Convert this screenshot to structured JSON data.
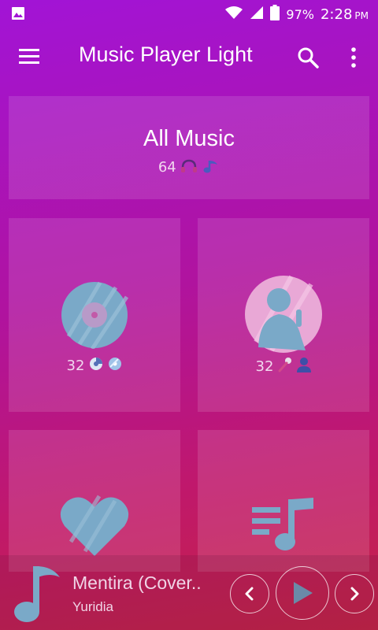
{
  "status": {
    "battery": "97%",
    "time": "2:28",
    "ampm": "PM"
  },
  "appbar": {
    "title": "Music Player Light"
  },
  "all_music": {
    "title": "All Music",
    "count": "64"
  },
  "albums": {
    "count": "32"
  },
  "artists": {
    "count": "32"
  },
  "now_playing": {
    "title": "Mentira (Cover..",
    "artist": "Yuridia"
  },
  "colors": {
    "icon_blue": "#7aa9c8",
    "accent_pink": "#e0a8d8"
  }
}
